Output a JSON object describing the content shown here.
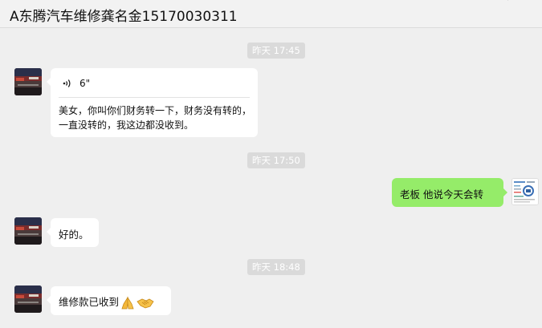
{
  "chat": {
    "title": "A东腾汽车维修龚名金15170030311"
  },
  "messages": {
    "ts1": "昨天 17:45",
    "voice": {
      "duration": "6\"",
      "transcript": "美女，你叫你们财务转一下，财务没有转的，一直没转的，我这边都没收到。"
    },
    "ts2": "昨天 17:50",
    "outgoing1": "老板 他说今天会转",
    "incoming2": "好的。",
    "ts3": "昨天 18:48",
    "incoming3": "维修款已收到"
  },
  "colors": {
    "outgoing_bubble": "#95ec69",
    "incoming_bubble": "#ffffff",
    "background": "#efefef",
    "timestamp_bg": "#dadada"
  },
  "icons": {
    "voice": "voice-wave-icon",
    "pray": "folded-hands-emoji",
    "handshake": "handshake-emoji"
  }
}
